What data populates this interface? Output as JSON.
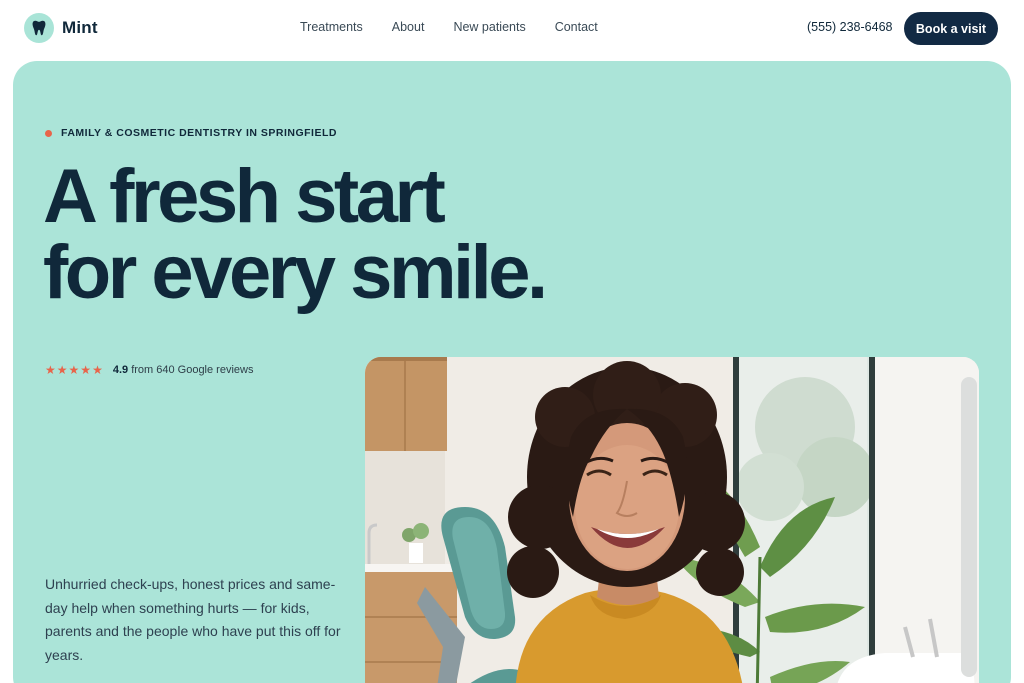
{
  "header": {
    "brand": "Mint",
    "nav": [
      {
        "label": "Treatments"
      },
      {
        "label": "About"
      },
      {
        "label": "New patients"
      },
      {
        "label": "Contact"
      }
    ],
    "phone": "(555) 238-6468",
    "book_label": "Book a visit"
  },
  "hero": {
    "eyebrow": "FAMILY & COSMETIC DENTISTRY IN SPRINGFIELD",
    "headline_line1": "A fresh start",
    "headline_line2": "for every smile.",
    "rating": {
      "score": "4.9",
      "text": "from 640 Google reviews",
      "stars": 5
    },
    "blurb": "Unhurried check-ups, honest prices and same-day help when something hurts — for kids, parents and the people who have put this off for years."
  },
  "colors": {
    "hero_bg": "#abe4d8",
    "navy": "#122a44",
    "accent": "#e8644a"
  },
  "icons": {
    "brand": "tooth-icon",
    "rating": "star-icon"
  }
}
